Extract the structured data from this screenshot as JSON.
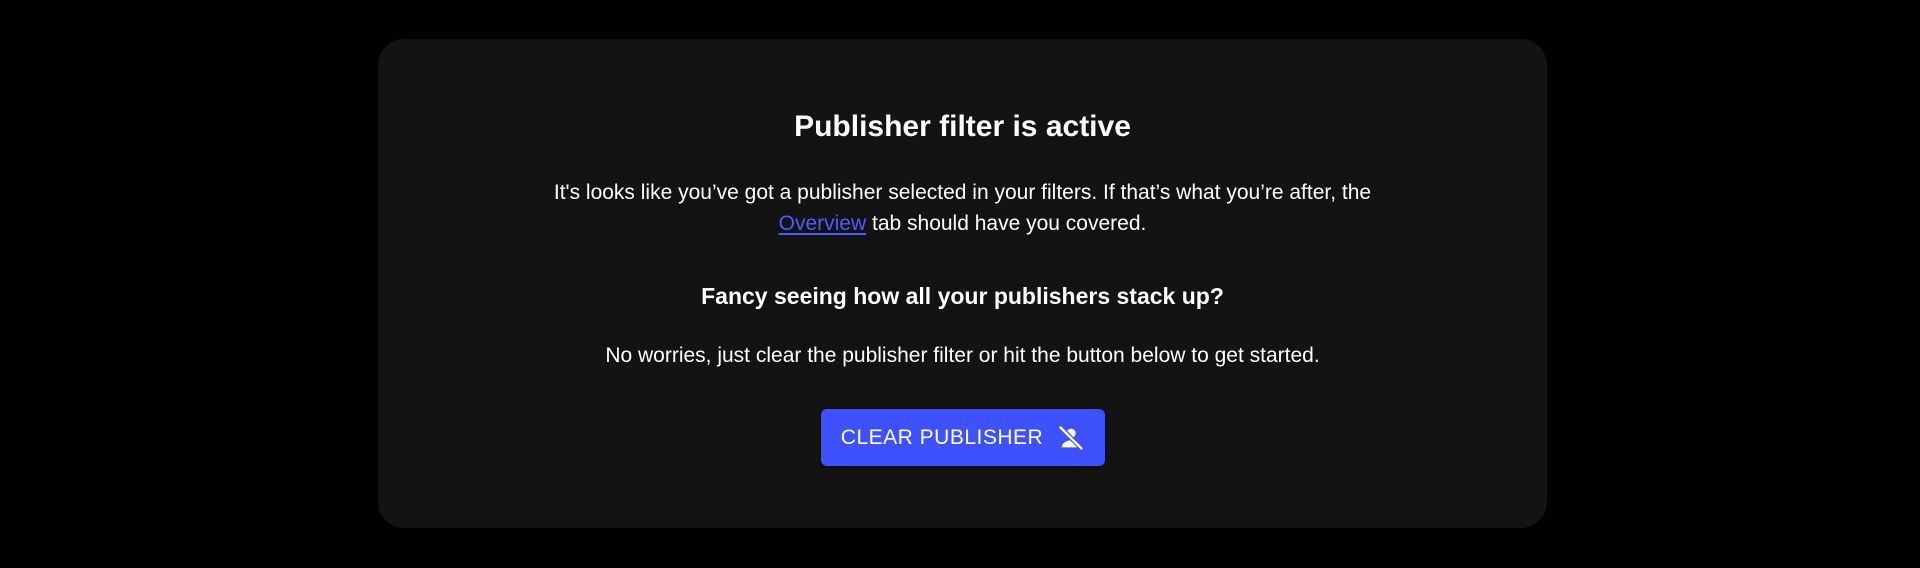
{
  "card": {
    "title": "Publisher filter is active",
    "intro_before": "It's looks like you’ve got a publisher selected in your filters. If that’s what you’re after, the",
    "intro_link": "Overview",
    "intro_after": " tab should have you covered.",
    "subtitle": "Fancy seeing how all your publishers stack up?",
    "hint": "No worries, just clear the publisher filter or hit the button below to get started.",
    "button_label": "CLEAR PUBLISHER",
    "button_icon": "person-off-icon"
  },
  "colors": {
    "page_background": "#000000",
    "card_background": "#131313",
    "accent": "#3f51fd",
    "link": "#4b5cff",
    "text": "#ffffff"
  }
}
